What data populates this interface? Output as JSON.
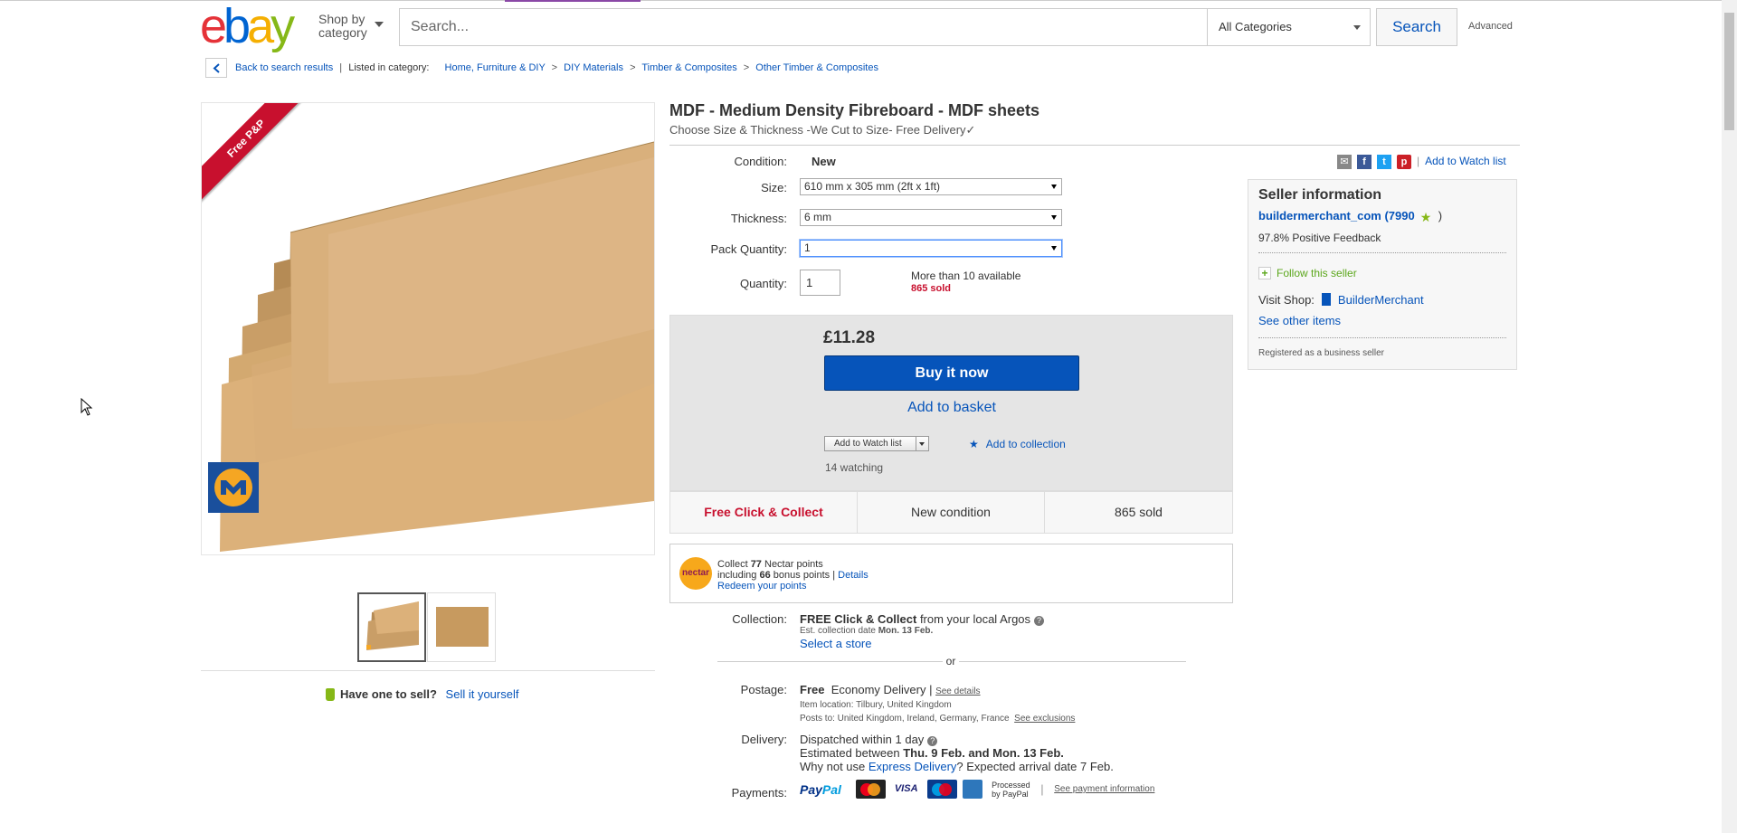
{
  "header": {
    "logo": [
      "e",
      "b",
      "a",
      "y"
    ],
    "shop_by": "Shop by",
    "category": "category",
    "search_placeholder": "Search...",
    "category_select": "All Categories",
    "search_button": "Search",
    "advanced": "Advanced"
  },
  "breadcrumb": {
    "back": "Back to search results",
    "listed_in": "Listed in category:",
    "items": [
      "Home, Furniture & DIY",
      "DIY Materials",
      "Timber & Composites",
      "Other Timber & Composites"
    ]
  },
  "gallery": {
    "ribbon": "Free P&P",
    "sell_prompt": "Have one to sell?",
    "sell_link": "Sell it yourself"
  },
  "item": {
    "title": "MDF - Medium Density Fibreboard - MDF sheets",
    "subtitle": "Choose Size & Thickness -We Cut to Size- Free Delivery✓",
    "condition_label": "Condition:",
    "condition": "New",
    "size_label": "Size:",
    "size": "610 mm x 305 mm (2ft x 1ft)",
    "thickness_label": "Thickness:",
    "thickness": "6 mm",
    "pack_label": "Pack Quantity:",
    "pack": "1",
    "quantity_label": "Quantity:",
    "quantity": "1",
    "available": "More than 10 available",
    "sold": "865 sold"
  },
  "share": {
    "watch": "Add to Watch list"
  },
  "buy": {
    "price": "£11.28",
    "buy_now": "Buy it now",
    "add_basket": "Add to basket",
    "watch_list": "Add to Watch list",
    "add_collection": "Add to collection",
    "watching": "14 watching"
  },
  "strip": [
    "Free Click & Collect",
    "New condition",
    "865 sold"
  ],
  "nectar": {
    "badge": "nectar",
    "collect_prefix": "Collect",
    "points": "77",
    "collect_suffix": "Nectar points",
    "including": "including",
    "bonus": "66",
    "bonus_suffix": "bonus points",
    "details": "Details",
    "redeem": "Redeem your points"
  },
  "collection": {
    "label": "Collection:",
    "free": "FREE Click & Collect",
    "from": "from your local Argos",
    "est_prefix": "Est. collection date",
    "est_date": "Mon. 13 Feb.",
    "select_store": "Select a store",
    "or": "or"
  },
  "postage": {
    "label": "Postage:",
    "free": "Free",
    "method": "Economy Delivery",
    "see_details": "See details",
    "location": "Item location:  Tilbury, United Kingdom",
    "posts_to": "Posts to:  United Kingdom, Ireland, Germany, France",
    "exclusions": "See exclusions"
  },
  "delivery": {
    "label": "Delivery:",
    "dispatched": "Dispatched within 1 day",
    "estimated_prefix": "Estimated between",
    "estimated_dates": "Thu. 9 Feb. and Mon. 13 Feb.",
    "why_prefix": "Why not use",
    "express": "Express Delivery",
    "why_suffix": "? Expected arrival date 7 Feb."
  },
  "payments": {
    "label": "Payments:",
    "paypal_a": "Pay",
    "paypal_b": "Pal",
    "processed_1": "Processed",
    "processed_2": "by PayPal",
    "see_info": "See payment information",
    "visa": "VISA"
  },
  "seller": {
    "heading": "Seller information",
    "name": "buildermerchant_com",
    "feedback_count": "(7990",
    "close_paren": ")",
    "positive": "97.8% Positive Feedback",
    "follow": "Follow this seller",
    "visit": "Visit Shop:",
    "shop_name": "BuilderMerchant",
    "other_items": "See other items",
    "registered": "Registered as a business seller"
  },
  "colors": {
    "brand_blue": "#0654ba",
    "sold_red": "#c8102e",
    "accent_green": "#86b817"
  }
}
